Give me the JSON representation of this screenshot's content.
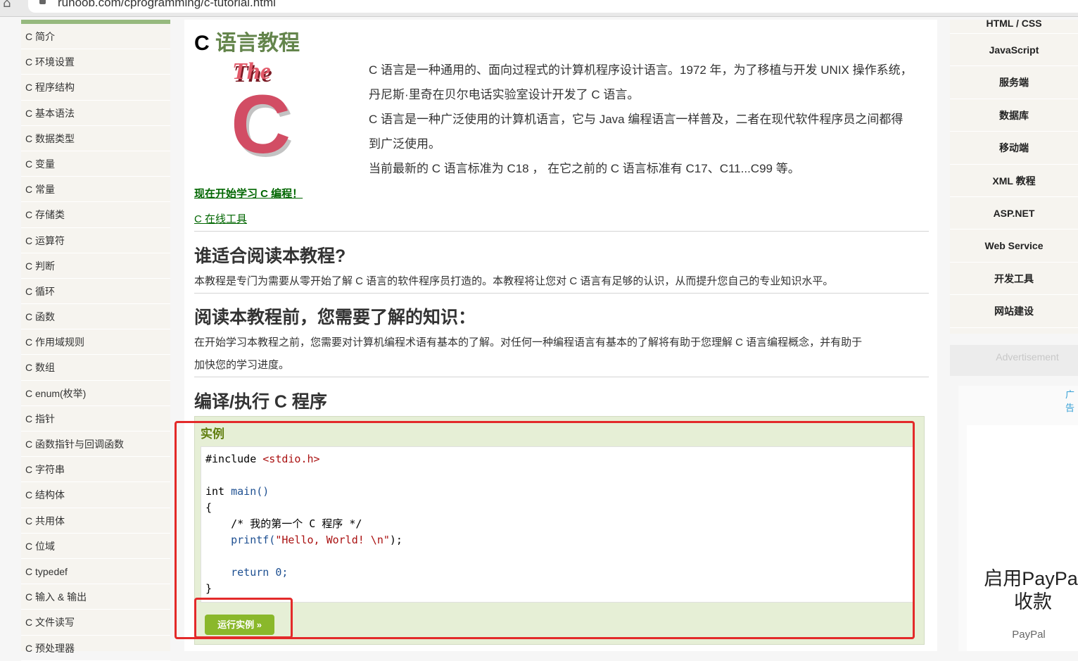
{
  "browser": {
    "url": "runoob.com/cprogramming/c-tutorial.html"
  },
  "sidebar": {
    "items": [
      "C 简介",
      "C 环境设置",
      "C 程序结构",
      "C 基本语法",
      "C 数据类型",
      "C 变量",
      "C 常量",
      "C 存储类",
      "C 运算符",
      "C 判断",
      "C 循环",
      "C 函数",
      "C 作用域规则",
      "C 数组",
      "C enum(枚举)",
      "C 指针",
      "C 函数指针与回调函数",
      "C 字符串",
      "C 结构体",
      "C 共用体",
      "C 位域",
      "C typedef",
      "C 输入 & 输出",
      "C 文件读写",
      "C 预处理器"
    ]
  },
  "main": {
    "title_c": "C",
    "title_rest": "语言教程",
    "logo_the": "The",
    "logo_c": "C",
    "intro": [
      "C 语言是一种通用的、面向过程式的计算机程序设计语言。1972 年，为了移植与开发 UNIX 操作系统，",
      "丹尼斯·里奇在贝尔电话实验室设计开发了 C 语言。",
      "C 语言是一种广泛使用的计算机语言，它与 Java 编程语言一样普及，二者在现代软件程序员之间都得",
      "到广泛使用。",
      "当前最新的 C 语言标准为 C18 ， 在它之前的 C 语言标准有 C17、C11...C99 等。"
    ],
    "link_start": "现在开始学习 C 编程！",
    "link_online": "C 在线工具",
    "h_who": "谁适合阅读本教程?",
    "p_who": "本教程是专门为需要从零开始了解 C 语言的软件程序员打造的。本教程将让您对 C 语言有足够的认识，从而提升您自己的专业知识水平。",
    "h_pre": "阅读本教程前，您需要了解的知识：",
    "p_pre_1": "在开始学习本教程之前，您需要对计算机编程术语有基本的了解。对任何一种编程语言有基本的了解将有助于您理解 C 语言编程概念，并有助于",
    "p_pre_2": "加快您的学习进度。",
    "h_compile": "编译/执行 C 程序",
    "example_label": "实例",
    "code": {
      "l1_a": "#include ",
      "l1_b": "<stdio.h>",
      "l3_a": "int ",
      "l3_b": "main()",
      "l4": "{",
      "l5": "    /* 我的第一个 C 程序 */",
      "l6_a": "    printf(",
      "l6_b": "\"Hello, World! \\n\"",
      "l6_c": ");",
      "l8": "    return 0;",
      "l9": "}"
    },
    "run_button": "运行实例 »"
  },
  "rightnav": {
    "items": [
      "HTML / CSS",
      "JavaScript",
      "服务端",
      "数据库",
      "移动端",
      "XML 教程",
      "ASP.NET",
      "Web Service",
      "开发工具",
      "网站建设"
    ]
  },
  "ad": {
    "label": "Advertisement",
    "corner": "广告",
    "title": "启用PayPal收款",
    "sub": "PayPal"
  },
  "colors": {
    "accent_green": "#64854c",
    "link_green": "#006600",
    "run_button": "#8ab82b",
    "highlight_red": "#e32a2a"
  }
}
